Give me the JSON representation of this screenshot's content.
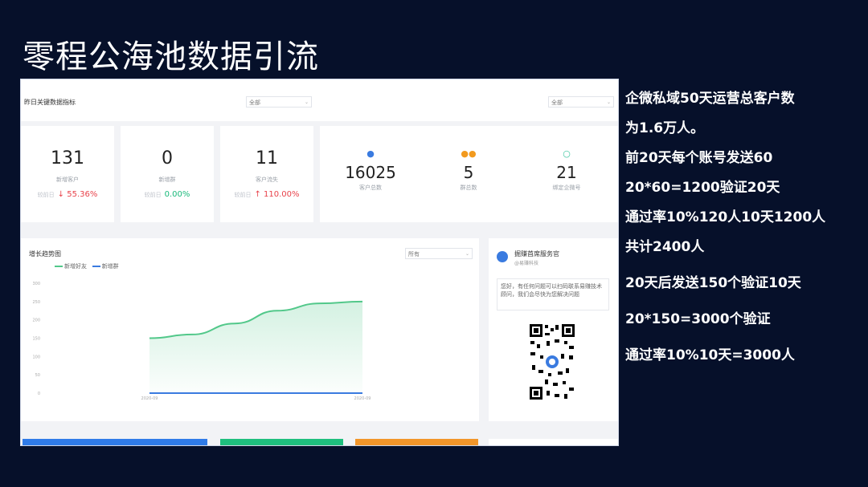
{
  "slide": {
    "title": "零程公海池数据引流"
  },
  "dashboard": {
    "header_title": "昨日关键数据指标",
    "filter1": "全部",
    "filter2": "全部",
    "kpis": [
      {
        "value": "131",
        "label": "新增客户",
        "cmp_label": "较前日",
        "change": "↓ 55.36%",
        "trend": "down"
      },
      {
        "value": "0",
        "label": "新增群",
        "cmp_label": "较前日",
        "change": "0.00%",
        "trend": "flat"
      },
      {
        "value": "11",
        "label": "客户流失",
        "cmp_label": "较前日",
        "change": "↑ 110.00%",
        "trend": "up"
      }
    ],
    "totals": [
      {
        "value": "16025",
        "label": "客户总数",
        "icon": "person-icon",
        "color": "#3a7be0"
      },
      {
        "value": "5",
        "label": "群总数",
        "icon": "group-icon",
        "color": "#f29a1f"
      },
      {
        "value": "21",
        "label": "绑定企微号",
        "icon": "leaf-icon",
        "color": "#3ec6a0"
      }
    ],
    "chart": {
      "title": "增长趋势图",
      "filter": "所有",
      "legend": [
        "新增好友",
        "新增群"
      ],
      "yticks": [
        "300",
        "250",
        "200",
        "150",
        "100",
        "50",
        "0"
      ],
      "xticks": [
        "2020-09",
        "2020-09"
      ]
    },
    "service": {
      "name": "掘赚首席服务官",
      "sub": "@易赚科技",
      "message": "您好，有任何问题可以扫码联系易赚技术顾问，我们会尽快为您解决问题"
    }
  },
  "chart_data": {
    "type": "line",
    "title": "增长趋势图",
    "x": [
      "2020-09",
      "2020-09"
    ],
    "ylim": [
      0,
      300
    ],
    "series": [
      {
        "name": "新增好友",
        "color": "#52c88a",
        "values": [
          150,
          160,
          190,
          225,
          245,
          250
        ]
      },
      {
        "name": "新增群",
        "color": "#3a7be0",
        "values": [
          0,
          0,
          0,
          0,
          0,
          0
        ]
      }
    ]
  },
  "notes": [
    "企微私域50天运营总客户数",
    "为1.6万人。",
    "前20天每个账号发送60",
    "20*60=1200验证20天",
    "通过率10%120人10天1200人",
    "共计2400人",
    "20天后发送150个验证10天",
    "20*150=3000个验证",
    "通过率10%10天=3000人"
  ],
  "colors": {
    "bg": "#06102a",
    "blue": "#3a7be0",
    "green": "#1fbf7e",
    "orange": "#f2962a"
  }
}
